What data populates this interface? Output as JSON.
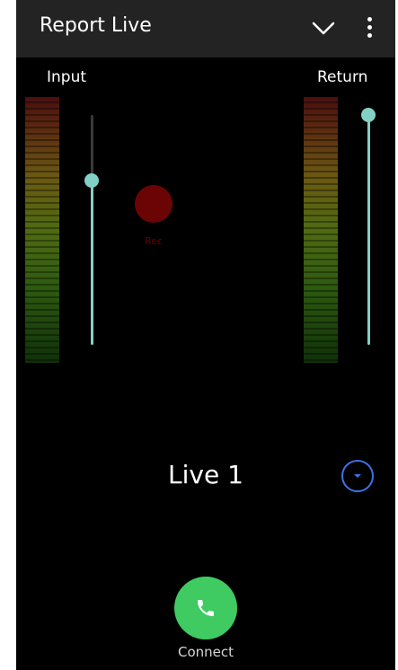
{
  "app": {
    "title": "Report Live"
  },
  "meters": {
    "input": {
      "label": "Input",
      "level": 0.71
    },
    "return": {
      "label": "Return",
      "level": 0.99
    }
  },
  "rec": {
    "label": "Rec",
    "color": "#6b0505"
  },
  "channel": {
    "name": "Live 1"
  },
  "connect": {
    "label": "Connect"
  },
  "colors": {
    "accent": "#83d1c4",
    "call": "#3fcb61",
    "dropdown": "#3f71e6"
  },
  "icons": [
    "chevron-down-icon",
    "more-vert-icon",
    "phone-icon",
    "arrow-down-icon"
  ]
}
